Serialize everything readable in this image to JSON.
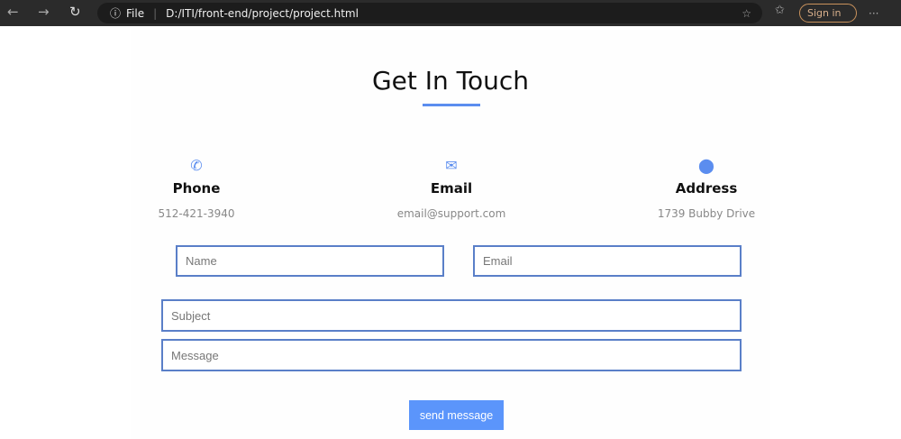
{
  "browser": {
    "file_label": "File",
    "url": "D:/ITI/front-end/project/project.html",
    "sign_in": "Sign in",
    "more": "···"
  },
  "heading": "Get In Touch",
  "contacts": [
    {
      "icon": "phone-icon",
      "title": "Phone",
      "value": "512-421-3940"
    },
    {
      "icon": "envelope-icon",
      "title": "Email",
      "value": "email@support.com"
    },
    {
      "icon": "map-pin-icon",
      "title": "Address",
      "value": "1739 Bubby Drive"
    }
  ],
  "form": {
    "name_placeholder": "Name",
    "email_placeholder": "Email",
    "subject_placeholder": "Subject",
    "message_placeholder": "Message",
    "submit": "send message"
  },
  "colors": {
    "accent": "#5b8def",
    "button": "#5b95fb",
    "input_border": "#5a7fc8"
  }
}
